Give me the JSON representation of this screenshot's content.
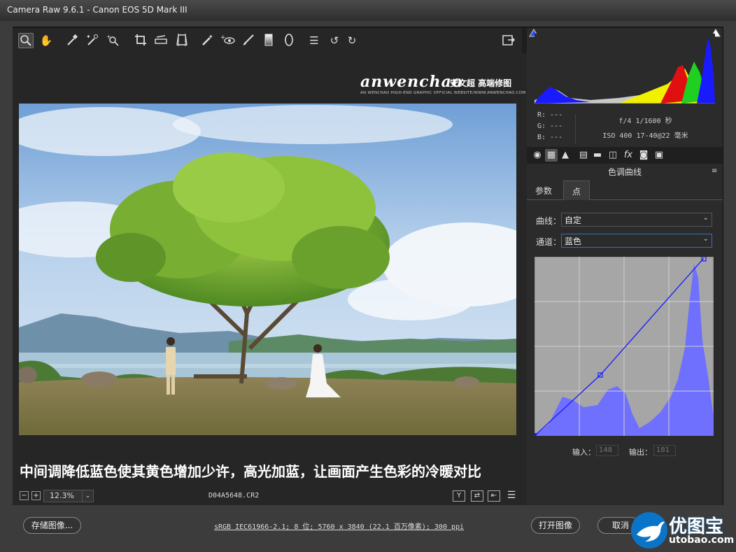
{
  "window": {
    "title": "Camera Raw 9.6.1 -  Canon EOS 5D Mark III"
  },
  "toolbar": {
    "tools": [
      "zoom-tool",
      "hand-tool",
      "white-balance-tool",
      "color-sampler-tool",
      "targeted-adjustment-tool",
      "crop-tool",
      "straighten-tool",
      "transform-tool",
      "spot-removal-tool",
      "red-eye-removal-tool",
      "adjustment-brush",
      "graduated-filter",
      "radial-filter",
      "open-preferences",
      "rotate-left",
      "rotate-right"
    ],
    "exit_fullscreen_icon": "export-icon"
  },
  "preview": {
    "logo_text": "anwenchao",
    "logo_cn": "安文超 高端修图",
    "logo_small": "AN WENCHAO HIGH-END GRAPHIC OFFICIAL WEBSITE/WWW.ANWENCHAO.COM",
    "caption": "中间调降低蓝色使其黄色增加少许，高光加蓝，让画面产生色彩的冷暖对比"
  },
  "statusbar": {
    "zoom_out": "−",
    "zoom_in": "+",
    "zoom_value": "12.3%",
    "zoom_arrow": "⌄",
    "filename": "D04A5648.CR2",
    "icons": [
      "Y",
      "⇄",
      "⇤",
      "☰"
    ]
  },
  "histogram": {
    "rgb": [
      "R: ---",
      "G: ---",
      "B: ---"
    ],
    "exif_line1": "f/4   1/1600 秒",
    "exif_line2": "ISO 400   17-40@22 毫米",
    "colors": {
      "red": "#e01010",
      "green": "#20d020",
      "blue": "#1a1aff",
      "yellow": "#f0f000",
      "gray": "#c8c8c8"
    }
  },
  "panel": {
    "tab_icons": [
      "◉",
      "▦",
      "▲",
      "▤",
      "▬",
      "◫",
      "fx",
      "◙",
      "▣"
    ],
    "title": "色调曲线",
    "menu_icon": "≡",
    "subtabs": [
      "参数",
      "点"
    ],
    "curve_label": "曲线：",
    "curve_value": "自定",
    "channel_label": "通道：",
    "channel_value": "蓝色",
    "dropdown_arrow": "⌄",
    "input_label": "输入：",
    "input_value": "148",
    "output_label": "输出：",
    "output_value": "181",
    "curve_color": "#1a1aff",
    "channel_fill": "#7070ff"
  },
  "bottom": {
    "save_button": "存储图像...",
    "workflow_link": "sRGB IEC61966-2.1; 8 位; 5760 x 3840 (22.1 百万像素); 300 ppi",
    "open_button": "打开图像",
    "cancel_button": "取消"
  },
  "watermark": {
    "cn": "优图宝",
    "url": "utobao.com"
  }
}
